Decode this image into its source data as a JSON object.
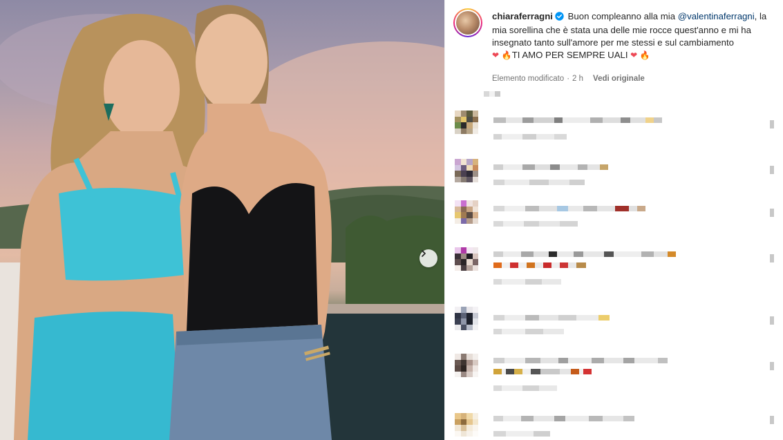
{
  "post": {
    "username": "chiaraferragni",
    "caption_start": "Buon compleanno alla mia",
    "mention": "@valentinaferragni",
    "caption_rest": ", la mia sorellina che è stata una delle mie rocce quest'anno e mi ha insegnato tanto sull'amore per me stessi e sul cambiamento",
    "caption_end": "TI AMO PER SEMPRE UALI",
    "edited_label": "Elemento modificato",
    "separator": "·",
    "time": "2 h",
    "see_original": "Vedi originale"
  },
  "icons": {
    "verified": "verified-badge-icon",
    "heart": "heart-emoji",
    "fire": "fire-emoji",
    "next": "chevron-right-icon"
  },
  "colors": {
    "mention": "#00376b",
    "verified": "#0095f6",
    "heart": "#ed4956",
    "meta_text": "#737373"
  }
}
